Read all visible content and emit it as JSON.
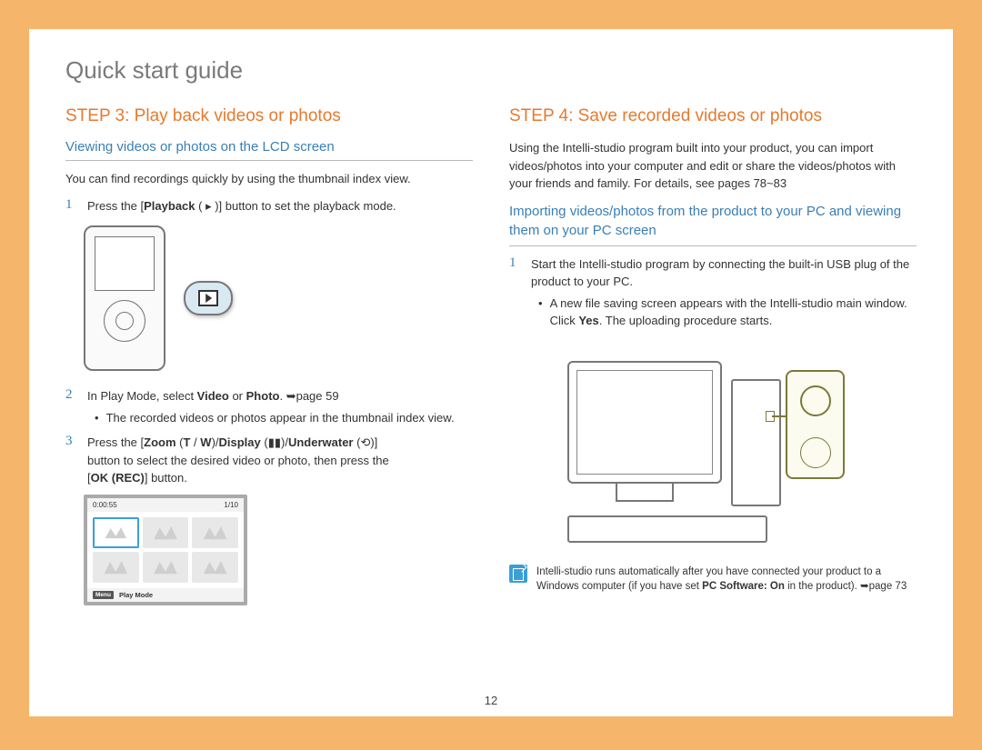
{
  "page_title": "Quick start guide",
  "page_number": "12",
  "left": {
    "step_heading": "STEP 3: Play back videos or photos",
    "subheading": "Viewing videos or photos on the LCD screen",
    "intro": "You can find recordings quickly by using the thumbnail index view.",
    "item1_pre": "Press the [",
    "item1_strong": "Playback",
    "item1_post": " ( ▸ )] button to set the playback mode.",
    "item2_pre": "In Play Mode, select ",
    "item2_b1": "Video",
    "item2_mid": " or ",
    "item2_b2": "Photo",
    "item2_post": ". ➥page 59",
    "item2_bullet": "The recorded videos or photos appear in the thumbnail index view.",
    "item3_pre": "Press the [",
    "item3_b1": "Zoom",
    "item3_paren1": " (",
    "item3_b2": "T",
    "item3_slash1": " / ",
    "item3_b3": "W",
    "item3_paren2": ")/",
    "item3_b4": "Display",
    "item3_disp_icon": " (▮▮)/",
    "item3_b5": "Underwater",
    "item3_uw_icon": " (⟲)]",
    "item3_line2": "button to select the desired video or photo, then press the",
    "item3_pre2": "[",
    "item3_b6": "OK (REC)",
    "item3_post2": "] button.",
    "thumb": {
      "time": "0:00:55",
      "count": "1/10",
      "mode_label": "Play Mode",
      "menu": "Menu"
    }
  },
  "right": {
    "step_heading": "STEP 4: Save recorded videos or photos",
    "intro": "Using the Intelli-studio program built into your product, you can import videos/photos into your computer and edit or share the videos/photos with your friends and family. For details, see pages 78~83",
    "subheading": "Importing videos/photos from the product to your PC and viewing them on your PC screen",
    "item1": "Start the Intelli-studio program by connecting the built-in USB plug of the product to your PC.",
    "item1_bullet_pre": "A new file saving screen appears with the Intelli-studio main window. Click ",
    "item1_bullet_b": "Yes",
    "item1_bullet_post": ". The uploading procedure starts.",
    "note_pre": "Intelli-studio runs automatically after you have connected your product to a Windows computer (if you have set ",
    "note_b": "PC Software: On",
    "note_post": " in the product). ➥page 73"
  }
}
